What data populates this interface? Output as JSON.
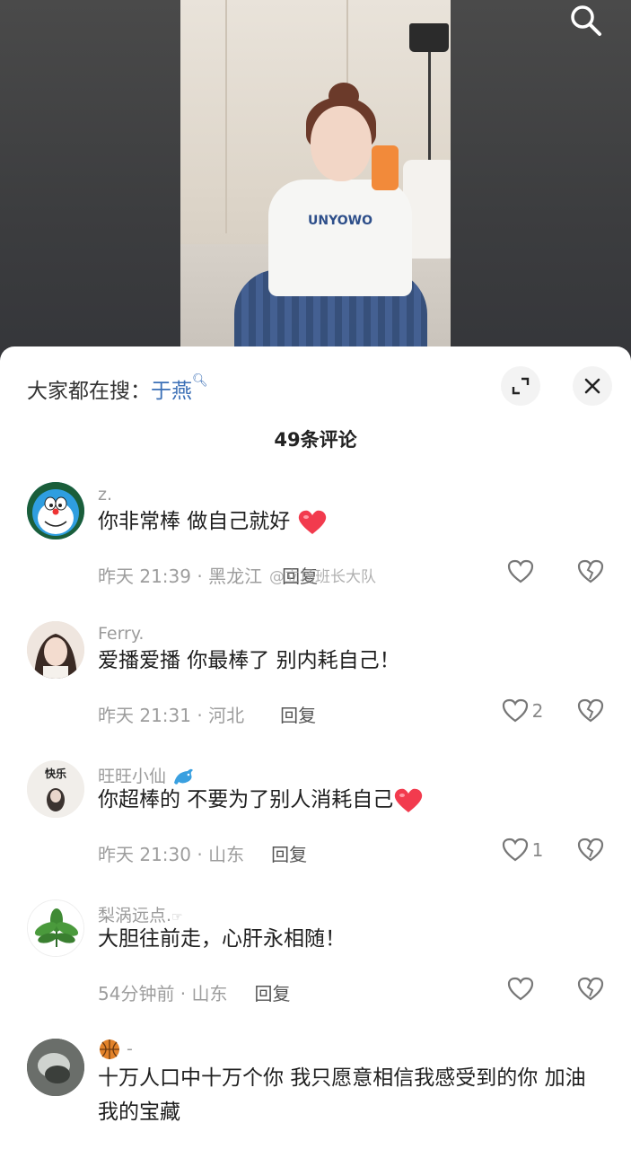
{
  "video": {
    "shirt_print": "UNYOWO"
  },
  "sheet": {
    "search_prefix": "大家都在搜：",
    "search_keyword": "于燕",
    "comment_count": "49条评论"
  },
  "watermark": "@立场班长大队",
  "comments": [
    {
      "username": "z.",
      "text": "你非常棒  做自己就好",
      "time": "昨天 21:39",
      "location": "黑龙江",
      "reply": "回复",
      "likes": ""
    },
    {
      "username": "Ferry.",
      "text": "爱播爱播 你最棒了 别内耗自己！",
      "time": "昨天 21:31",
      "location": "河北",
      "reply": "回复",
      "likes": "2"
    },
    {
      "username": "旺旺小仙",
      "avatar_text": "快乐",
      "text": "你超棒的 不要为了别人消耗自己",
      "time": "昨天 21:30",
      "location": "山东",
      "reply": "回复",
      "likes": "1"
    },
    {
      "username": "梨涡远点.",
      "text": "大胆往前走，心肝永相随！",
      "time": "54分钟前",
      "location": "山东",
      "reply": "回复",
      "likes": ""
    },
    {
      "username": "-",
      "text": "十万人口中十万个你  我只愿意相信我感受到的你  加油 我的宝藏"
    }
  ],
  "colors": {
    "keyword": "#3b6fb6",
    "heart": "#f23b4e"
  }
}
